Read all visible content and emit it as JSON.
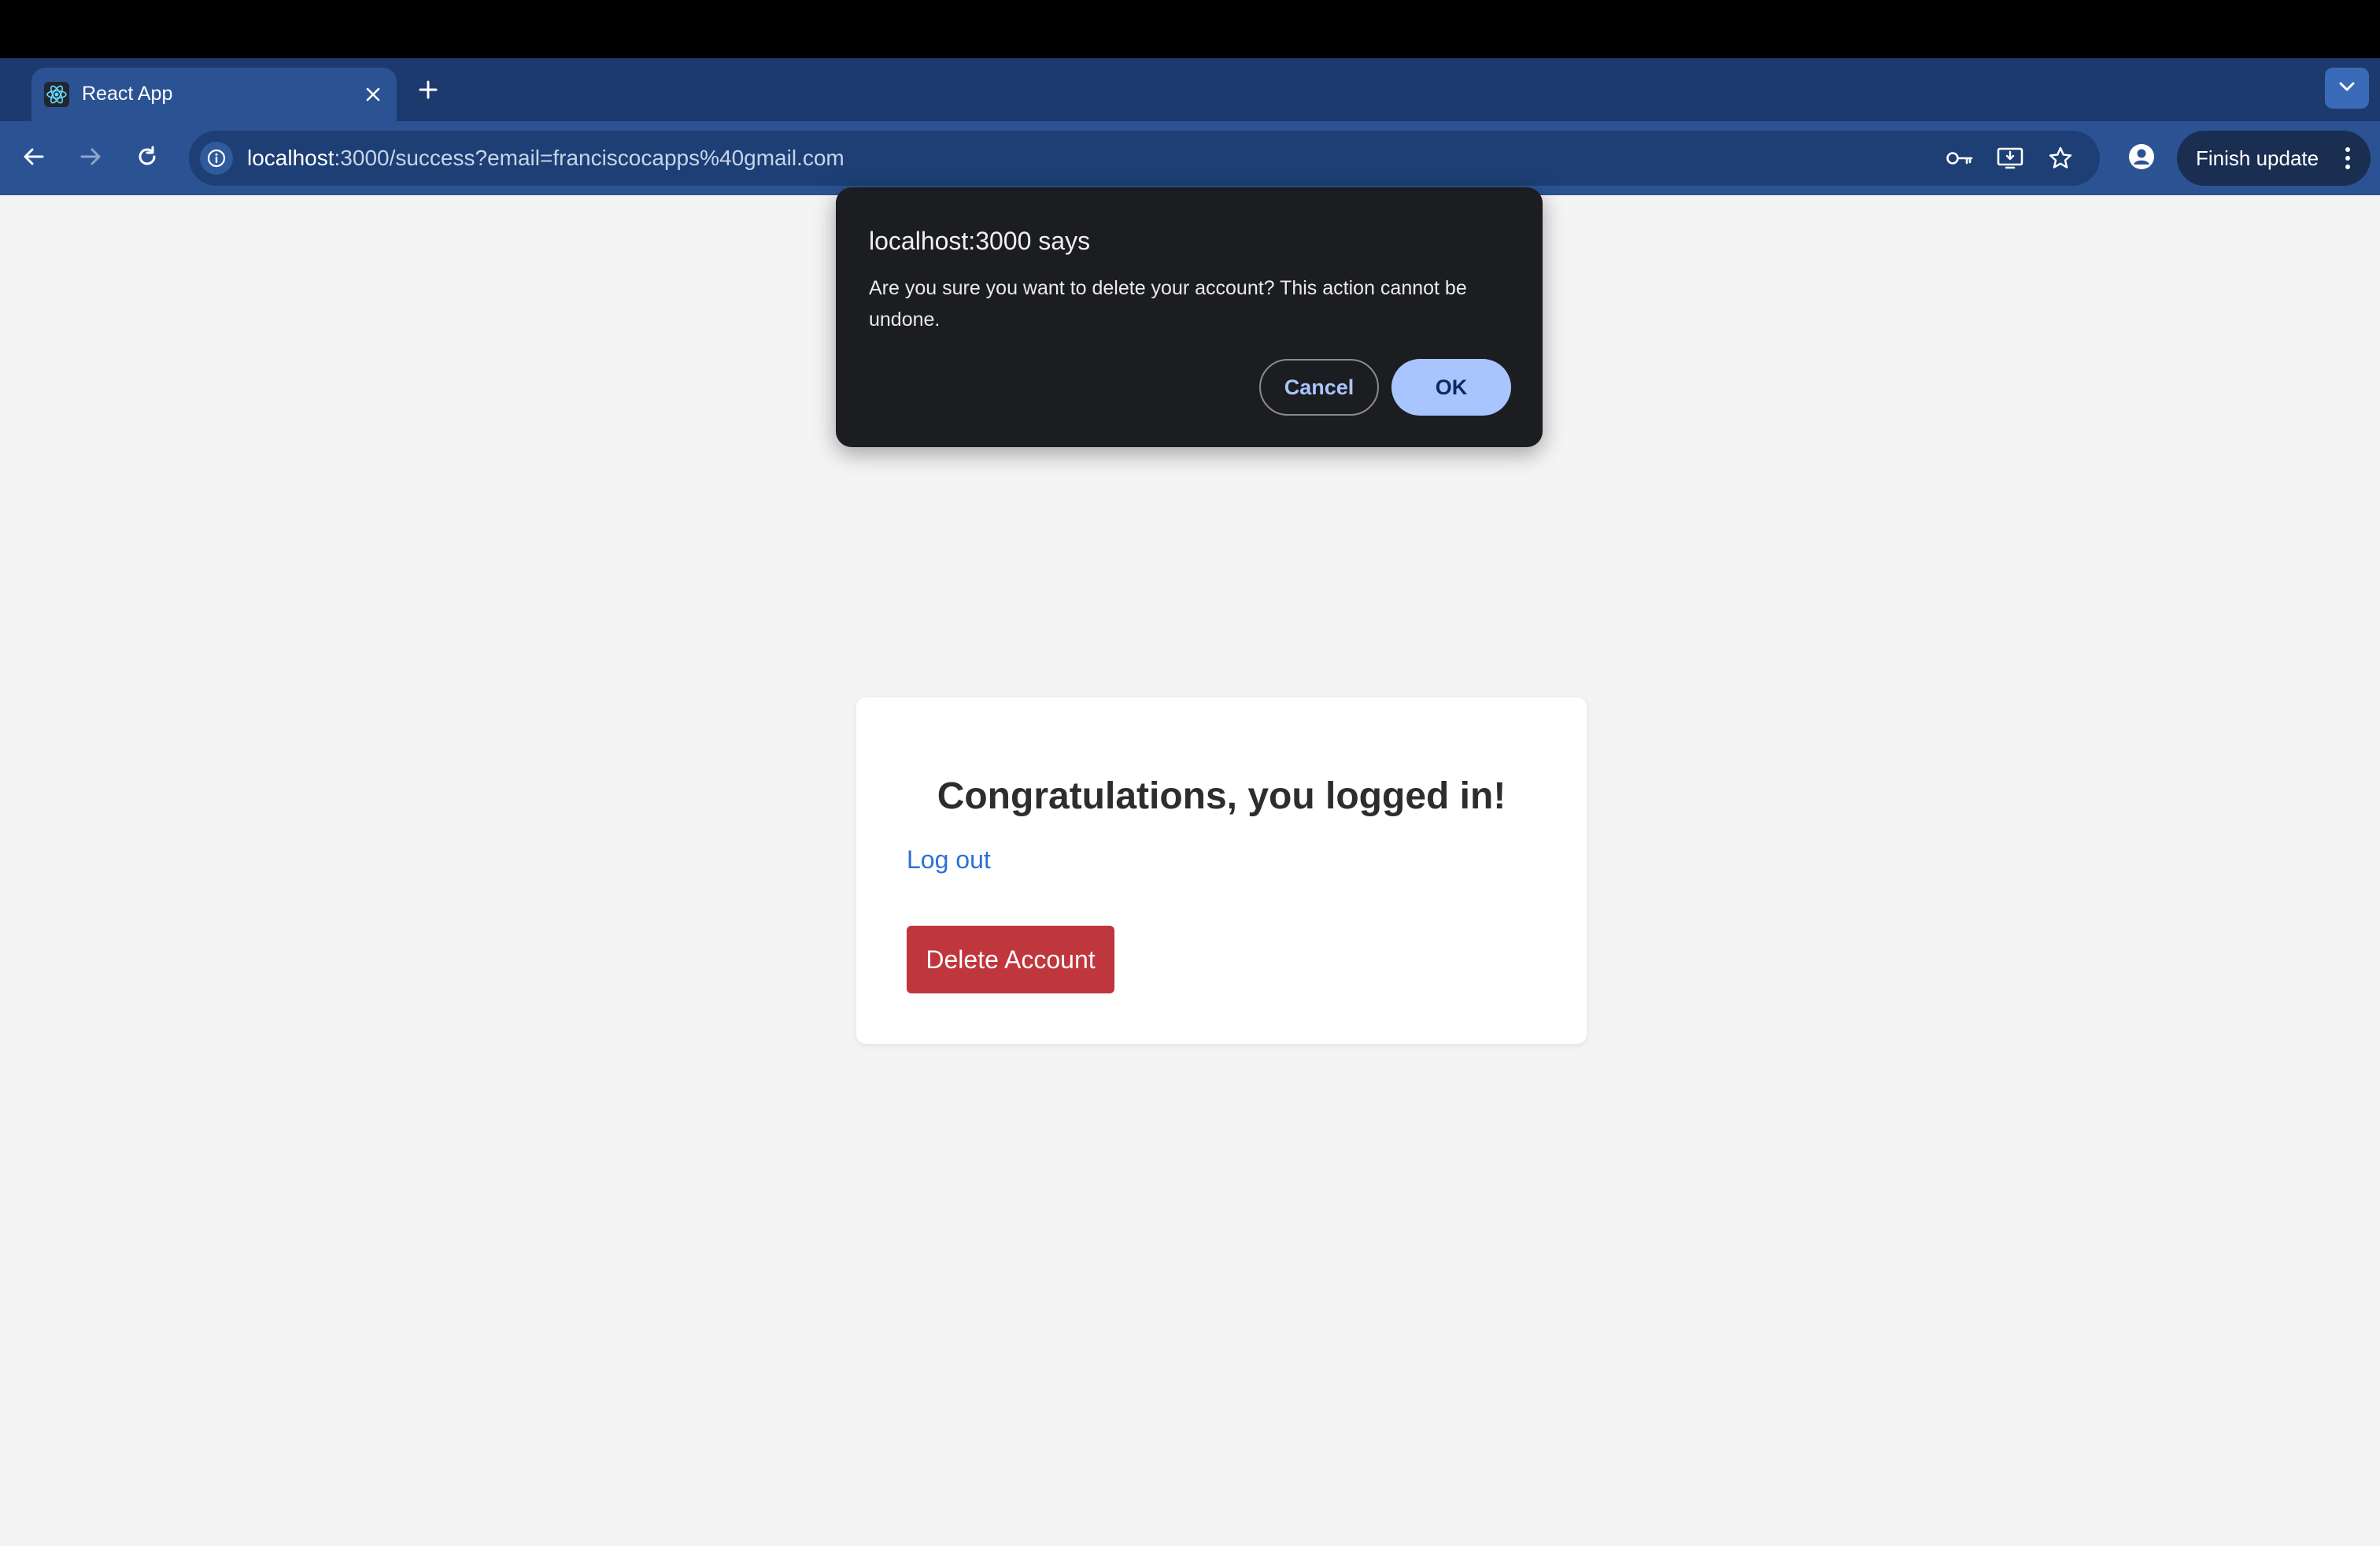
{
  "browser": {
    "tab": {
      "title": "React App"
    },
    "url": {
      "host": "localhost",
      "rest": ":3000/success?email=franciscocapps%40gmail.com"
    },
    "finish_update_label": "Finish update",
    "icons": [
      "react-favicon-icon",
      "close-icon",
      "plus-icon",
      "chevron-down-icon",
      "back-arrow-icon",
      "forward-arrow-icon",
      "reload-icon",
      "info-icon",
      "key-icon",
      "install-app-icon",
      "star-icon",
      "profile-icon",
      "kebab-menu-icon"
    ]
  },
  "dialog": {
    "title": "localhost:3000 says",
    "message": "Are you sure you want to delete your account? This action cannot be undone.",
    "cancel_label": "Cancel",
    "ok_label": "OK"
  },
  "page": {
    "heading": "Congratulations, you logged in!",
    "logout_label": "Log out",
    "delete_label": "Delete Account"
  },
  "colors": {
    "tabstrip": "#1d3a6e",
    "toolbar": "#2b5394",
    "delete_button": "#bf363c",
    "link": "#2f6fd6",
    "dialog_bg": "#1c1d21",
    "ok_button": "#a8c5ff"
  }
}
